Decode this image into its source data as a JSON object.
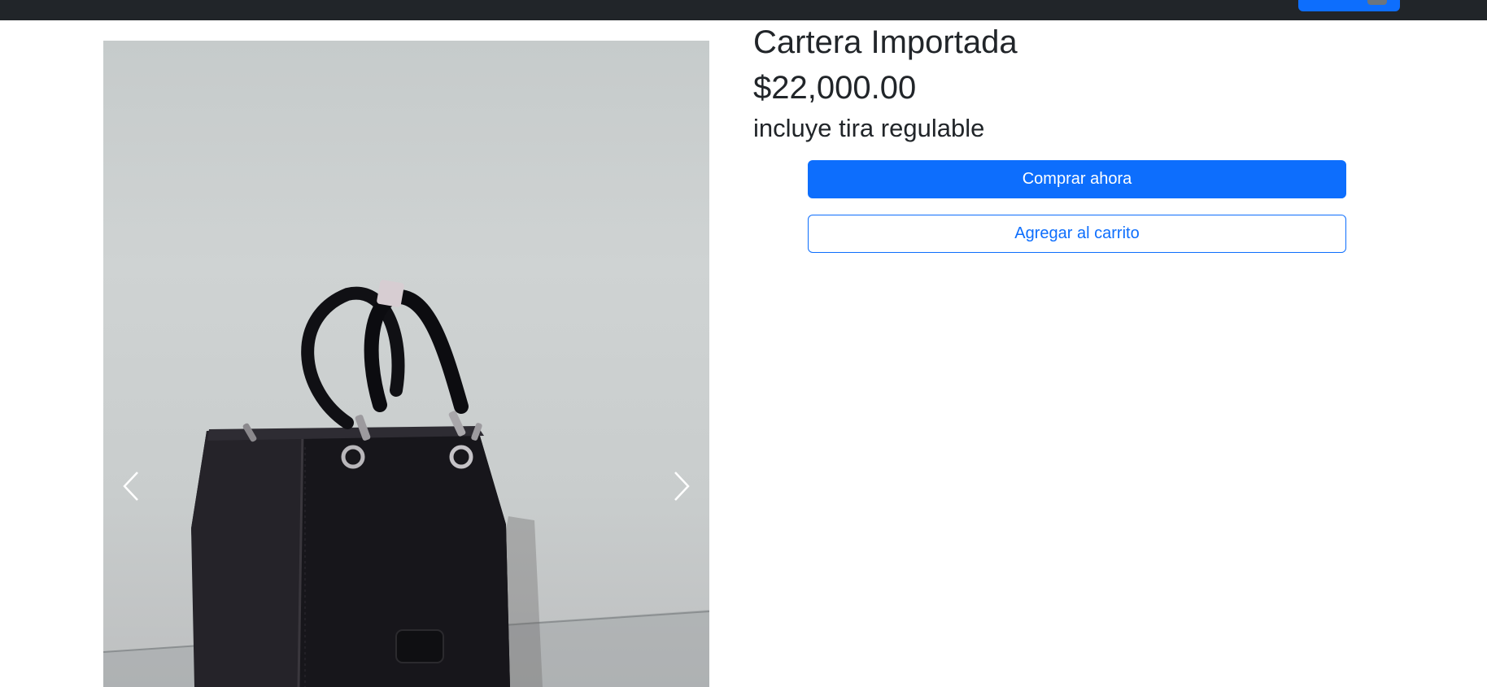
{
  "navbar": {
    "background": "#212529",
    "cart_button_color": "#0d6efd"
  },
  "product": {
    "title": "Cartera Importada",
    "price": "$22,000.00",
    "description": "incluye tira regulable",
    "image_subject": "black leather handbag"
  },
  "carousel": {
    "prev_icon": "chevron-left-icon",
    "next_icon": "chevron-right-icon"
  },
  "actions": {
    "buy_now_label": "Comprar ahora",
    "add_to_cart_label": "Agregar al carrito"
  },
  "colors": {
    "primary": "#0d6efd",
    "text": "#212529",
    "dark": "#212529"
  }
}
